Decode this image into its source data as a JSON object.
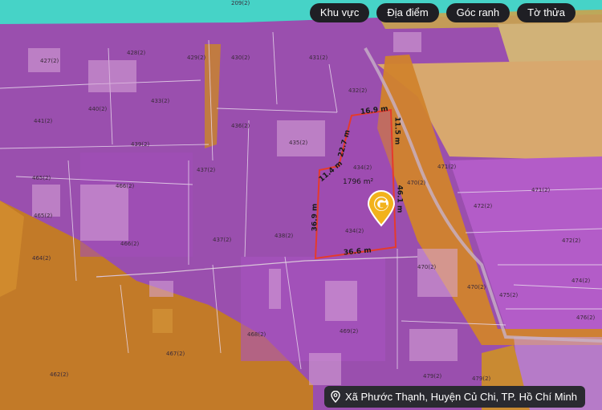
{
  "toolbar": {
    "buttons": [
      "Khu vực",
      "Địa điểm",
      "Góc ranh",
      "Tờ thửa"
    ]
  },
  "address": {
    "text": "Xã Phước Thạnh, Huyện Củ Chi, TP. Hồ Chí Minh",
    "icon": "location-pin-icon"
  },
  "parcel": {
    "area": "1796 m²",
    "number": "434(2)",
    "number_alt": "434(2)",
    "edges": {
      "top": "16.9 m",
      "right_upper": "11.5 m",
      "diag": "22.7 m",
      "left_upper": "11.4 m",
      "right": "46.1 m",
      "left": "36.9 m",
      "bottom": "36.6 m"
    }
  },
  "lot_labels": {
    "l209": "209(2)",
    "l427": "427(2)",
    "l428": "428(2)",
    "l429": "429(2)",
    "l430": "430(2)",
    "l431": "431(2)",
    "l432": "432(2)",
    "l433": "433(2)",
    "l436": "436(2)",
    "l435": "435(2)",
    "l437": "437(2)",
    "l437b": "437(2)",
    "l438": "438(2)",
    "l439": "439(2)",
    "l440": "440(2)",
    "l441": "441(2)",
    "l465": "465(2)",
    "l465b": "465(2)",
    "l466": "466(2)",
    "l466b": "466(2)",
    "l464": "464(2)",
    "l470": "470(2)",
    "l470b": "470(2)",
    "l471": "471(2)",
    "l471b": "471(2)",
    "l472": "472(2)",
    "l472b": "472(2)",
    "l474": "474(2)",
    "l475": "475(2)",
    "l476": "476(2)",
    "l468": "468(2)",
    "l469": "469(2)",
    "l479": "479(2)",
    "l479b": "479(2)",
    "l467": "467(2)",
    "l462": "462(2)"
  },
  "colors": {
    "residential": "#b45bc9",
    "agricultural": "#c9842a",
    "water": "#3fd6c6",
    "parcel_border": "#e53b2c",
    "brand": "#f2b21b"
  }
}
